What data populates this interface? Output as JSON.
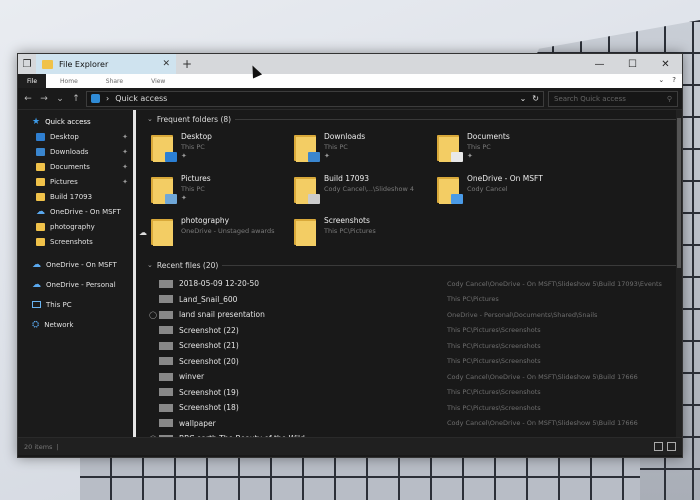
{
  "window": {
    "tab_title": "File Explorer",
    "new_tab": "+",
    "caption": {
      "min": "—",
      "max": "☐",
      "close": "✕"
    }
  },
  "ribbon": {
    "file": "File",
    "tabs": [
      "Home",
      "Share",
      "View"
    ]
  },
  "address": {
    "back": "←",
    "forward": "→",
    "recent": "⌄",
    "up": "↑",
    "crumb": "Quick access",
    "search_placeholder": "Search Quick access"
  },
  "sidebar": {
    "quick_access": "Quick access",
    "quick_items": [
      {
        "label": "Desktop",
        "icon": "desktop-folder-icon",
        "pinned": true
      },
      {
        "label": "Downloads",
        "icon": "downloads-folder-icon",
        "pinned": true
      },
      {
        "label": "Documents",
        "icon": "documents-folder-icon",
        "pinned": true
      },
      {
        "label": "Pictures",
        "icon": "pictures-folder-icon",
        "pinned": true
      },
      {
        "label": "Build 17093",
        "icon": "folder-icon",
        "pinned": false
      },
      {
        "label": "OneDrive - On MSFT",
        "icon": "onedrive-icon",
        "pinned": false
      },
      {
        "label": "photography",
        "icon": "folder-icon",
        "pinned": false
      },
      {
        "label": "Screenshots",
        "icon": "folder-icon",
        "pinned": false
      }
    ],
    "roots": [
      {
        "label": "OneDrive - On MSFT",
        "icon": "onedrive-icon"
      },
      {
        "label": "OneDrive - Personal",
        "icon": "onedrive-icon"
      },
      {
        "label": "This PC",
        "icon": "this-pc-icon"
      },
      {
        "label": "Network",
        "icon": "network-icon"
      }
    ]
  },
  "frequent": {
    "heading": "Frequent folders (8)",
    "items": [
      {
        "name": "Desktop",
        "loc": "This PC",
        "pinned": true,
        "emblem": "#2b7fd4"
      },
      {
        "name": "Downloads",
        "loc": "This PC",
        "pinned": true,
        "emblem": "#3a86cf"
      },
      {
        "name": "Documents",
        "loc": "This PC",
        "pinned": true,
        "emblem": "#e8e8e8"
      },
      {
        "name": "Pictures",
        "loc": "This PC",
        "pinned": true,
        "emblem": "#6fa7d8"
      },
      {
        "name": "Build 17093",
        "loc": "Cody Cancel\\...\\Slideshow 4",
        "pinned": false,
        "emblem": "#cccccc"
      },
      {
        "name": "OneDrive - On MSFT",
        "loc": "Cody Cancel",
        "pinned": false,
        "emblem": "#4a9be8"
      },
      {
        "name": "photography",
        "loc": "OneDrive - Unstaged awards",
        "pinned": false,
        "emblem": ""
      },
      {
        "name": "Screenshots",
        "loc": "This PC\\Pictures",
        "pinned": false,
        "emblem": ""
      }
    ]
  },
  "recent": {
    "heading": "Recent files (20)",
    "files": [
      {
        "name": "2018-05-09 12-20-50",
        "path": "Cody Cancel\\OneDrive - On MSFT\\Slideshow 5\\Build 17093\\Events",
        "status": ""
      },
      {
        "name": "Land_Snail_600",
        "path": "This PC\\Pictures",
        "status": ""
      },
      {
        "name": "land snail presentation",
        "path": "OneDrive - Personal\\Documents\\Shared\\Snails",
        "status": "◯"
      },
      {
        "name": "Screenshot (22)",
        "path": "This PC\\Pictures\\Screenshots",
        "status": ""
      },
      {
        "name": "Screenshot (21)",
        "path": "This PC\\Pictures\\Screenshots",
        "status": ""
      },
      {
        "name": "Screenshot (20)",
        "path": "This PC\\Pictures\\Screenshots",
        "status": ""
      },
      {
        "name": "winver",
        "path": "Cody Cancel\\OneDrive - On MSFT\\Slideshow 5\\Build 17666",
        "status": ""
      },
      {
        "name": "Screenshot (19)",
        "path": "This PC\\Pictures\\Screenshots",
        "status": ""
      },
      {
        "name": "Screenshot (18)",
        "path": "This PC\\Pictures\\Screenshots",
        "status": ""
      },
      {
        "name": "wallpaper",
        "path": "Cody Cancel\\OneDrive - On MSFT\\Slideshow 5\\Build 17666",
        "status": ""
      },
      {
        "name": "BBC earth The Beauty of the Wild",
        "path": "",
        "status": "◯"
      }
    ]
  },
  "status": {
    "items": "20 items"
  }
}
